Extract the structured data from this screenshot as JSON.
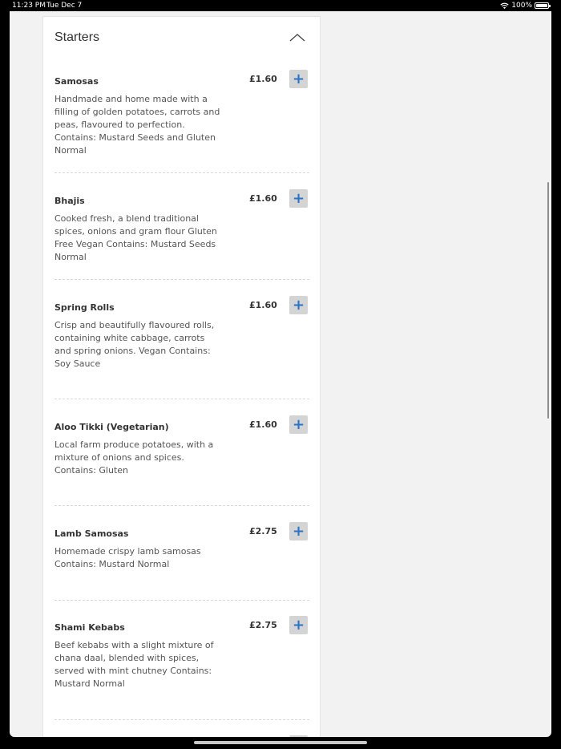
{
  "status_bar": {
    "time": "11:23 PM",
    "date": "Tue Dec 7",
    "battery": "100%",
    "wifi_icon": "wifi-icon",
    "battery_icon": "battery-icon"
  },
  "section": {
    "title": "Starters",
    "collapse_icon": "chevron-up-icon"
  },
  "items": [
    {
      "name": "Samosas",
      "price": "£1.60",
      "add_label": "+",
      "description": "Handmade and home made with a filling of golden potatoes, carrots and peas, flavoured to perfection. Contains: Mustard Seeds and Gluten Normal"
    },
    {
      "name": "Bhajis",
      "price": "£1.60",
      "add_label": "+",
      "description": "Cooked fresh, a blend traditional spices, onions and gram flour Gluten Free Vegan Contains: Mustard Seeds Normal"
    },
    {
      "name": "Spring Rolls",
      "price": "£1.60",
      "add_label": "+",
      "description": "Crisp and beautifully flavoured rolls, containing white cabbage, carrots and spring onions. Vegan Contains: Soy Sauce"
    },
    {
      "name": "Aloo Tikki (Vegetarian)",
      "price": "£1.60",
      "add_label": "+",
      "description": "Local farm produce potatoes, with a mixture of onions and spices. Contains: Gluten"
    },
    {
      "name": "Lamb Samosas",
      "price": "£2.75",
      "add_label": "+",
      "description": "Homemade crispy lamb samosas Contains: Mustard Normal"
    },
    {
      "name": "Shami Kebabs",
      "price": "£2.75",
      "add_label": "+",
      "description": "Beef kebabs with a slight mixture of chana daal, blended with spices, served with mint chutney Contains: Mustard Normal"
    }
  ],
  "colors": {
    "accent": "#2a74c8",
    "add_button_bg": "#d4d4d4",
    "page_bg": "#f2f2f2"
  }
}
